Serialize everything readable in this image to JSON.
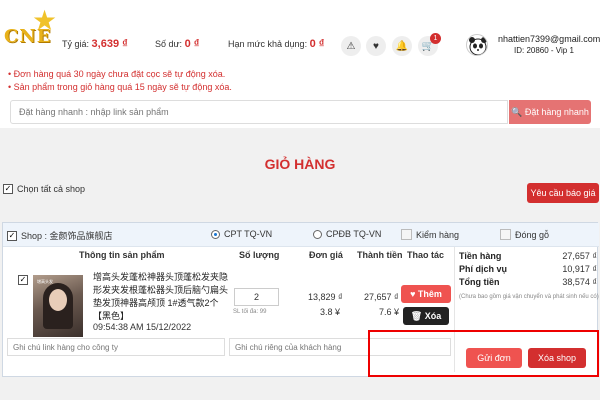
{
  "header": {
    "logo_text": "CNE",
    "rate_label": "Tỷ giá:",
    "rate_value": "3,639 ₫",
    "balance_label": "Số dư:",
    "balance_value": "0 ₫",
    "limit_label": "Hạn mức khả dụng:",
    "limit_value": "0 ₫",
    "icons": [
      "warning-icon",
      "heart-icon",
      "bell-icon",
      "cart-icon"
    ],
    "cart_count": "1",
    "user_email": "nhattien7399@gmail.com",
    "user_id": "ID: 20860 - Vip 1"
  },
  "notices": [
    "Đơn hàng quá 30 ngày chưa đặt cọc sẽ tự động xóa.",
    "Sản phẩm trong giỏ hàng quá 15 ngày sẽ tự động xóa."
  ],
  "quick_order": {
    "placeholder": "Đặt hàng nhanh : nhập link sản phẩm",
    "button": "Đặt hàng nhanh"
  },
  "cart_title": "GIỎ HÀNG",
  "select_all": "Chọn tất cả shop",
  "quote_button": "Yêu cầu báo giá",
  "shop": {
    "name": "Shop : 金颜饰品旗舰店",
    "options": {
      "cpt": "CPT TQ-VN",
      "cpdb": "CPĐB TQ-VN",
      "check": "Kiểm hàng",
      "pack": "Đóng gỗ"
    },
    "columns": [
      "Thông tin sản phẩm",
      "Số lượng",
      "Đơn giá",
      "Thành tiền",
      "Thao tác"
    ],
    "item": {
      "name": "增高头发蓬松神器头顶蓬松发夹隐形发夹发根蓬松器头顶后脑勺扁头垫发顶神器高颅顶 1#透气款2个【黑色】",
      "thumb_text": "增高头发",
      "time": "09:54:38 AM 15/12/2022",
      "quantity": "2",
      "min_qty": "SL tối đa: 99",
      "unit_price": "13,829 ₫",
      "unit_price_cny": "3.8 ¥",
      "total": "27,657 ₫",
      "total_cny": "7.6 ¥",
      "like_button": "Thêm",
      "delete_button": "Xóa"
    },
    "summary": {
      "goods_label": "Tiền hàng",
      "goods_value": "27,657 ₫",
      "service_label": "Phí dịch vụ",
      "service_value": "10,917 ₫",
      "total_label": "Tổng tiền",
      "total_value": "38,574 ₫",
      "note": "(Chưa bao gồm giá vận chuyển và phát sinh nếu có)"
    },
    "note_shop_placeholder": "Ghi chú link hàng cho công ty",
    "note_customer_placeholder": "Ghi chú riêng của khách hàng",
    "send_button": "Gửi đơn",
    "delete_shop_button": "Xóa shop"
  }
}
